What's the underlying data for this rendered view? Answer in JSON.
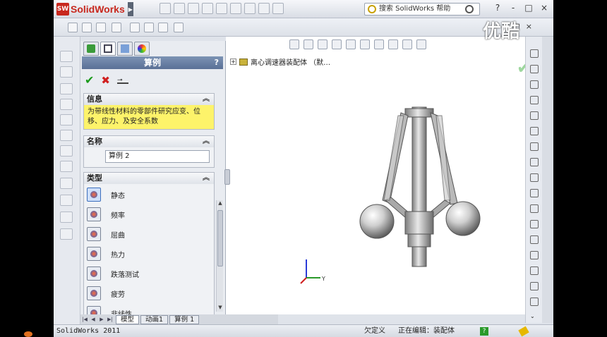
{
  "app": {
    "logo_badge": "SW",
    "name": "SolidWorks",
    "search_placeholder": "搜索 SolidWorks 帮助",
    "window_buttons": [
      "?",
      "-",
      "□",
      "×"
    ],
    "doc_window_buttons": [
      "-",
      "□",
      "×"
    ]
  },
  "watermark": "优酷",
  "panel": {
    "tabs": [
      "feature-manager",
      "property-manager",
      "configuration-manager",
      "appearance-manager"
    ],
    "title": "算例",
    "help": "?",
    "message": {
      "header": "信息",
      "text": "为带线性材料的零部件研究应变、位移、应力、及安全系数"
    },
    "name_group": {
      "header": "名称",
      "value": "算例 2"
    },
    "type_group": {
      "header": "类型",
      "items": [
        "静态",
        "频率",
        "屈曲",
        "热力",
        "跌落测试",
        "疲劳",
        "非线性"
      ],
      "selected_index": 0
    }
  },
  "bottom_tabs": [
    "模型",
    "动画1",
    "算例 1"
  ],
  "viewport": {
    "tree_label": "离心调速器装配体 （默…",
    "triad": {
      "y": "Y"
    }
  },
  "status": {
    "app_version": "SolidWorks 2011",
    "state": "欠定义",
    "editing": "正在编辑：装配体",
    "help_icon": "?"
  }
}
